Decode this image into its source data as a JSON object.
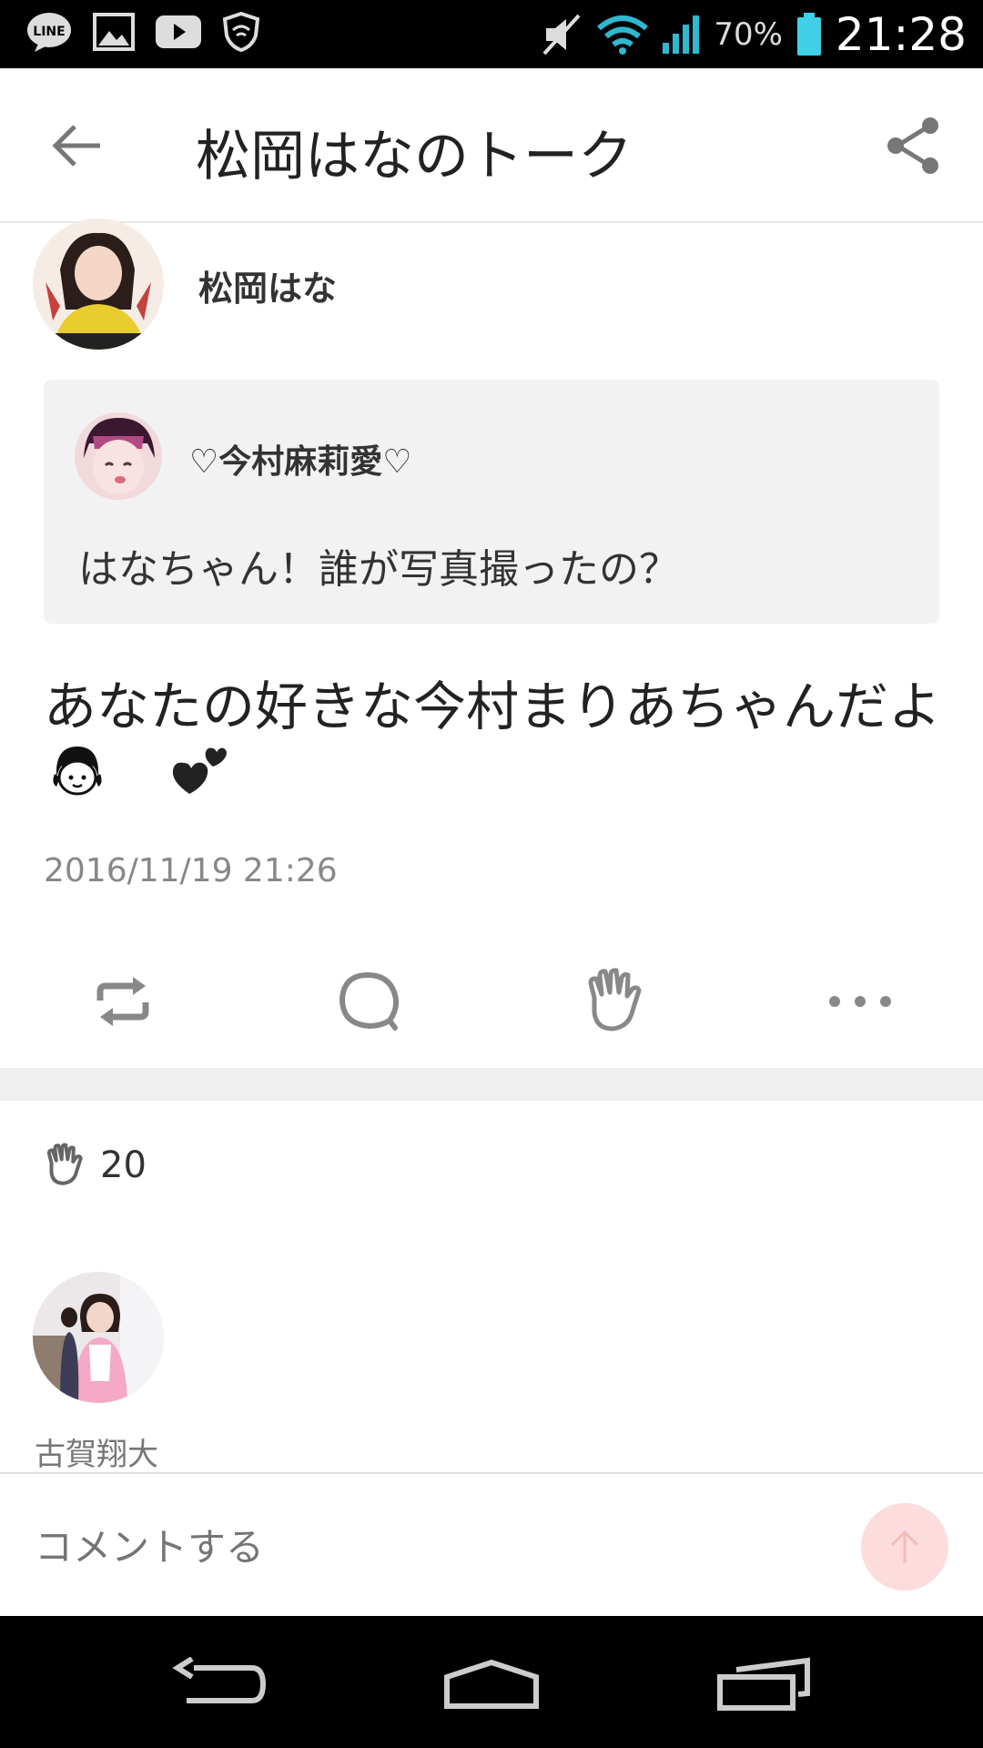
{
  "status_bar": {
    "battery_percent": "70%",
    "time": "21:28",
    "icons": [
      "line-icon",
      "gallery-icon",
      "youtube-icon",
      "shield-icon",
      "mute-icon",
      "wifi-icon",
      "signal-icon",
      "battery-icon"
    ]
  },
  "header": {
    "title": "松岡はなのトーク",
    "back_icon": "arrow-left-icon",
    "share_icon": "share-icon"
  },
  "post": {
    "author_name": "松岡はな",
    "quote": {
      "author_name": "♡今村麻莉愛♡",
      "text": "はなちゃん！誰が写真撮ったの？"
    },
    "text": "あなたの好きな今村まりあちゃんだよ",
    "timestamp": "2016/11/19 21:26"
  },
  "actions": [
    "repost-icon",
    "comment-icon",
    "clap-icon",
    "more-icon"
  ],
  "claps": {
    "count": "20"
  },
  "commenter": {
    "name": "古賀翔大"
  },
  "comment_bar": {
    "placeholder": "コメントする"
  },
  "navbar": [
    "nav-back-icon",
    "nav-home-icon",
    "nav-recents-icon"
  ],
  "colors": {
    "accent": "#fcdcdc",
    "icon_gray": "#888888",
    "band": "#efefef"
  }
}
